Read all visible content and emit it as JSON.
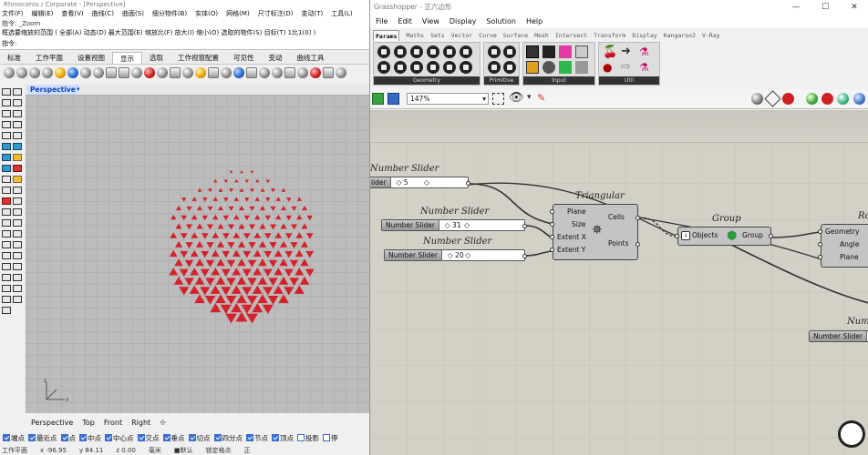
{
  "rhino": {
    "title": "Rhinoceros / Corporate - [Perspective]",
    "menu": [
      "文件(F)",
      "编辑(E)",
      "查看(V)",
      "曲线(C)",
      "曲面(S)",
      "细分物件(B)",
      "实体(O)",
      "网格(M)",
      "尺寸标注(D)",
      "变动(T)",
      "工具(L)"
    ],
    "cmd_history": "指令: _Zoom",
    "cmd_line1": "框选要缩放的范围 ( 全部(A) 动态(D) 最大范围(E) 缩放比(F) 放大(I) 缩小(O) 选取的物件(S) 目标(T) 1比1(0) )",
    "cmd_line2": "指令:",
    "tabs": [
      "标准",
      "工作平面",
      "设置视图",
      "显示",
      "选取",
      "工作视窗配置",
      "可见性",
      "变动",
      "曲线工具"
    ],
    "active_tab_index": 3,
    "viewport_label": "Perspective",
    "viewport_tabs": [
      "Perspective",
      "Top",
      "Front",
      "Right"
    ],
    "osnaps": [
      {
        "label": "端点",
        "on": true
      },
      {
        "label": "最近点",
        "on": true
      },
      {
        "label": "点",
        "on": true
      },
      {
        "label": "中点",
        "on": true
      },
      {
        "label": "中心点",
        "on": true
      },
      {
        "label": "交点",
        "on": true
      },
      {
        "label": "垂点",
        "on": true
      },
      {
        "label": "切点",
        "on": true
      },
      {
        "label": "四分点",
        "on": true
      },
      {
        "label": "节点",
        "on": true
      },
      {
        "label": "顶点",
        "on": true
      },
      {
        "label": "投影",
        "on": false
      },
      {
        "label": "停",
        "on": false
      }
    ],
    "status": [
      "工作平面",
      "x -96.95",
      "y 84.11",
      "z 0.00",
      "毫米",
      "■默认",
      "锁定格点",
      "正"
    ],
    "pattern_color": "#d4222a"
  },
  "gh": {
    "title": "Grasshopper - 正六边形",
    "menu": [
      "File",
      "Edit",
      "View",
      "Display",
      "Solution",
      "Help"
    ],
    "tabs": [
      "Params",
      "Maths",
      "Sets",
      "Vector",
      "Curve",
      "Surface",
      "Mesh",
      "Intersect",
      "Transform",
      "Display",
      "Kangaroo2",
      "V-Ray"
    ],
    "ribbon_groups": [
      "Geometry",
      "Primitive",
      "Input",
      "Util"
    ],
    "zoom": "147%",
    "components": {
      "slider1_title": "Number Slider",
      "slider1_name": "lider",
      "slider1_value": "5",
      "slider2_title": "Number Slider",
      "slider2_name": "Number Slider",
      "slider2_value": "31",
      "slider3_title": "Number Slider",
      "slider3_name": "Number Slider",
      "slider3_value": "20",
      "triangular_title": "Triangular",
      "triangular_inputs": [
        "Plane",
        "Size",
        "Extent X",
        "Extent Y"
      ],
      "triangular_outputs": [
        "Cells",
        "Points"
      ],
      "group_title": "Group",
      "group_input": "Objects",
      "group_output": "Group",
      "rotate_title": "Ro",
      "rotate_inputs": [
        "Geometry",
        "Angle",
        "Plane"
      ],
      "slider4_title": "Num",
      "slider4_name": "Number Slider"
    }
  }
}
